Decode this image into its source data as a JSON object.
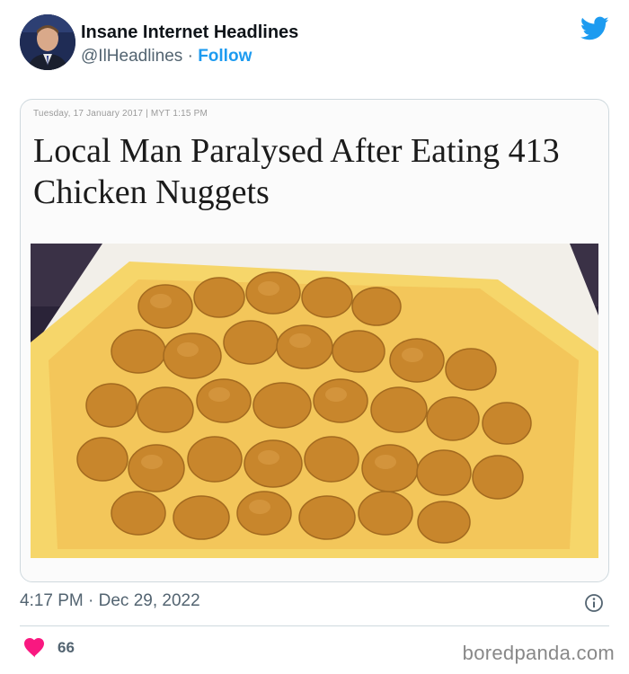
{
  "author": {
    "display_name": "Insane Internet Headlines",
    "handle": "@IlHeadlines",
    "separator": "·",
    "follow_label": "Follow"
  },
  "media": {
    "article_date": "Tuesday, 17 January 2017 | MYT 1:15 PM",
    "headline": "Local Man Paralysed After Eating 413 Chicken Nuggets"
  },
  "tweet": {
    "timestamp": "4:17 PM · Dec 29, 2022",
    "like_count": "66"
  },
  "watermark": "boredpanda.com",
  "icons": {
    "brand": "twitter-bird-icon",
    "info": "info-icon",
    "like": "heart-icon"
  },
  "colors": {
    "accent": "#1d9bf0",
    "heart": "#f91880",
    "muted": "#536471"
  }
}
